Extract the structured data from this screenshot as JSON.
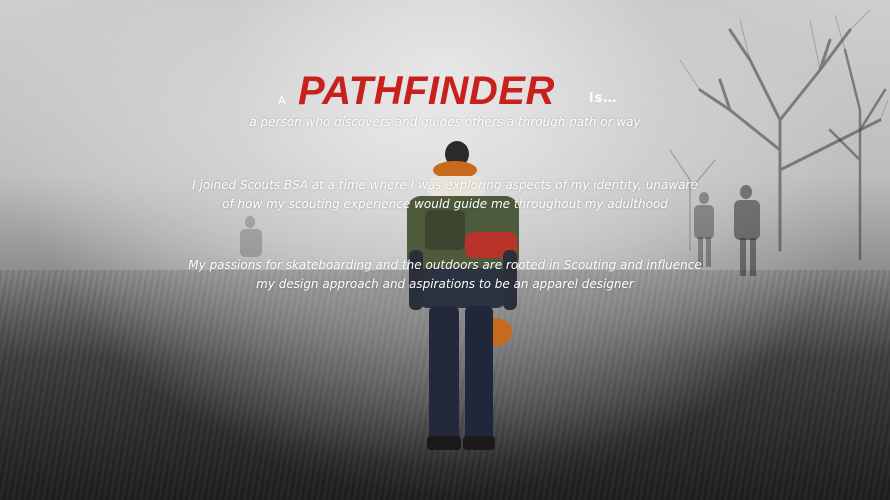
{
  "title": {
    "prefix": "A",
    "word": "PATHFINDER",
    "suffix": "is…"
  },
  "definition": "a person who discovers and guides others a through path or way",
  "paragraphs": [
    {
      "line1": "I joined Scouts BSA at a time where I was exploring aspects of my identity, unaware",
      "line2": "of how my scouting experience would guide me throughout my adulthood"
    },
    {
      "line1": "My passions for skateboarding and the outdoors are rooted in Scouting and influence",
      "line2": "my design approach and aspirations to be an apparel designer"
    }
  ],
  "colors": {
    "accent": "#c8201c",
    "text": "#ffffff"
  },
  "background_image": "foggy-trail-hiker-photo"
}
